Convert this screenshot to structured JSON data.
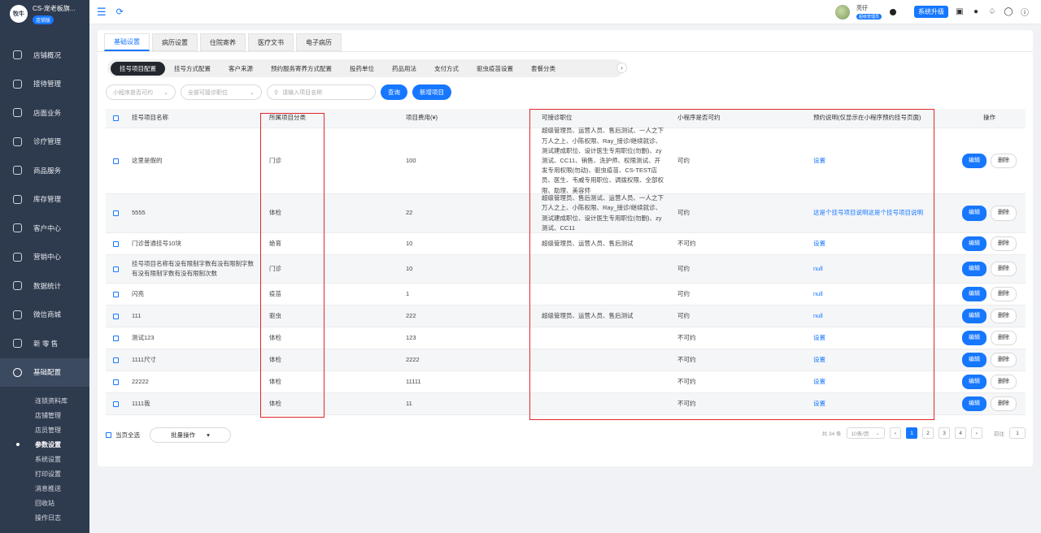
{
  "brand": {
    "logo_text": "牧牛",
    "name": "CS-宠老板旗...",
    "badge": "连锁版"
  },
  "menu": [
    {
      "label": "店铺概况",
      "icon": "monitor-icon"
    },
    {
      "label": "接待管理",
      "icon": "reception-icon"
    },
    {
      "label": "店面业务",
      "icon": "store-icon"
    },
    {
      "label": "诊疗管理",
      "icon": "medical-icon"
    },
    {
      "label": "商品服务",
      "icon": "goods-icon"
    },
    {
      "label": "库存管理",
      "icon": "inventory-icon"
    },
    {
      "label": "客户中心",
      "icon": "customer-icon"
    },
    {
      "label": "营销中心",
      "icon": "marketing-icon"
    },
    {
      "label": "数据统计",
      "icon": "stats-icon"
    },
    {
      "label": "微信商城",
      "icon": "wechat-mall-icon"
    },
    {
      "label": "新 零 售",
      "icon": "retail-icon"
    },
    {
      "label": "基础配置",
      "icon": "settings-icon"
    }
  ],
  "submenu": [
    "连锁资料库",
    "店铺管理",
    "店员管理",
    "参数设置",
    "系统设置",
    "打印设置",
    "消息推送",
    "回收站",
    "操作日志"
  ],
  "header": {
    "user_name": "亮仔",
    "user_role": "超级管理员",
    "upgrade_label": "系统升级"
  },
  "top_tabs": [
    "基础设置",
    "病历设置",
    "住院寄养",
    "医疗文书",
    "电子病历"
  ],
  "sub_tabs": [
    "挂号项目配置",
    "挂号方式配置",
    "客户来源",
    "预约服务寄养方式配置",
    "投药单位",
    "药品用法",
    "支付方式",
    "驱虫疫苗设置",
    "套餐分类"
  ],
  "filters": {
    "mini_placeholder": "小程序是否可约",
    "position_placeholder": "全部可接诊职位",
    "search_placeholder": "请输入项目名称",
    "query_label": "查询",
    "add_label": "新增项目"
  },
  "table": {
    "headers": [
      "挂号项目名称",
      "所属项目分类",
      "项目费用(¥)",
      "可接诊职位",
      "小程序是否可约",
      "预约说明(仅显示在小程序预约挂号页面)",
      "操作"
    ],
    "edit_label": "编辑",
    "delete_label": "删除",
    "rows": [
      {
        "name": "这里是假的",
        "category": "门诊",
        "fee": "100",
        "positions": "超级管理员、运营人员、售后测试、一人之下万人之上、小陈权限、Ray_接诊/继续就诊、测试建成职位、设计医生专用职位(勿删)、zy测试、CC11、销售、洗护师、权限测试、开发专用权限(勿动)、驱虫疫苗、CS-TEST店员、医生、韦威专用职位、调拨权限、全部权限、助理、美容师",
        "mini": "可约",
        "note": "设置"
      },
      {
        "name": "5555",
        "category": "体检",
        "fee": "22",
        "positions": "超级管理员、售后测试、运营人员、一人之下万人之上、小陈权限、Ray_接诊/继续就诊、测试建成职位、设计医生专用职位(勿删)、zy测试、CC11",
        "mini": "可约",
        "note": "这是个挂号项目说明这是个挂号项目说明"
      },
      {
        "name": "门诊普通挂号10块",
        "category": "绝育",
        "fee": "10",
        "positions": "超级管理员、运营人员、售后测试",
        "mini": "不可约",
        "note": "设置"
      },
      {
        "name": "挂号项目名称有没有限制字数有没有限制字数有没有限制字数有没有限制次数",
        "category": "门诊",
        "fee": "10",
        "positions": "",
        "mini": "可约",
        "note": "null"
      },
      {
        "name": "闪亮",
        "category": "疫苗",
        "fee": "1",
        "positions": "",
        "mini": "可约",
        "note": "null"
      },
      {
        "name": "111",
        "category": "驱虫",
        "fee": "222",
        "positions": "超级管理员、运营人员、售后测试",
        "mini": "可约",
        "note": "null"
      },
      {
        "name": "测试123",
        "category": "体检",
        "fee": "123",
        "positions": "",
        "mini": "不可约",
        "note": "设置"
      },
      {
        "name": "1111尺寸",
        "category": "体检",
        "fee": "2222",
        "positions": "",
        "mini": "不可约",
        "note": "设置"
      },
      {
        "name": "22222",
        "category": "体检",
        "fee": "11111",
        "positions": "",
        "mini": "不可约",
        "note": "设置"
      },
      {
        "name": "1111我",
        "category": "体检",
        "fee": "11",
        "positions": "",
        "mini": "不可约",
        "note": "设置"
      }
    ]
  },
  "footer": {
    "select_all_label": "当页全选",
    "batch_label": "批量操作",
    "total_text": "共 34 条",
    "page_size": "10条/页",
    "pages": [
      "1",
      "2",
      "3",
      "4"
    ],
    "goto_label": "前往",
    "goto_value": "1"
  },
  "colors": {
    "accent": "#1677ff",
    "sidebar": "#2e3a4d",
    "annotation": "#e0262b"
  }
}
